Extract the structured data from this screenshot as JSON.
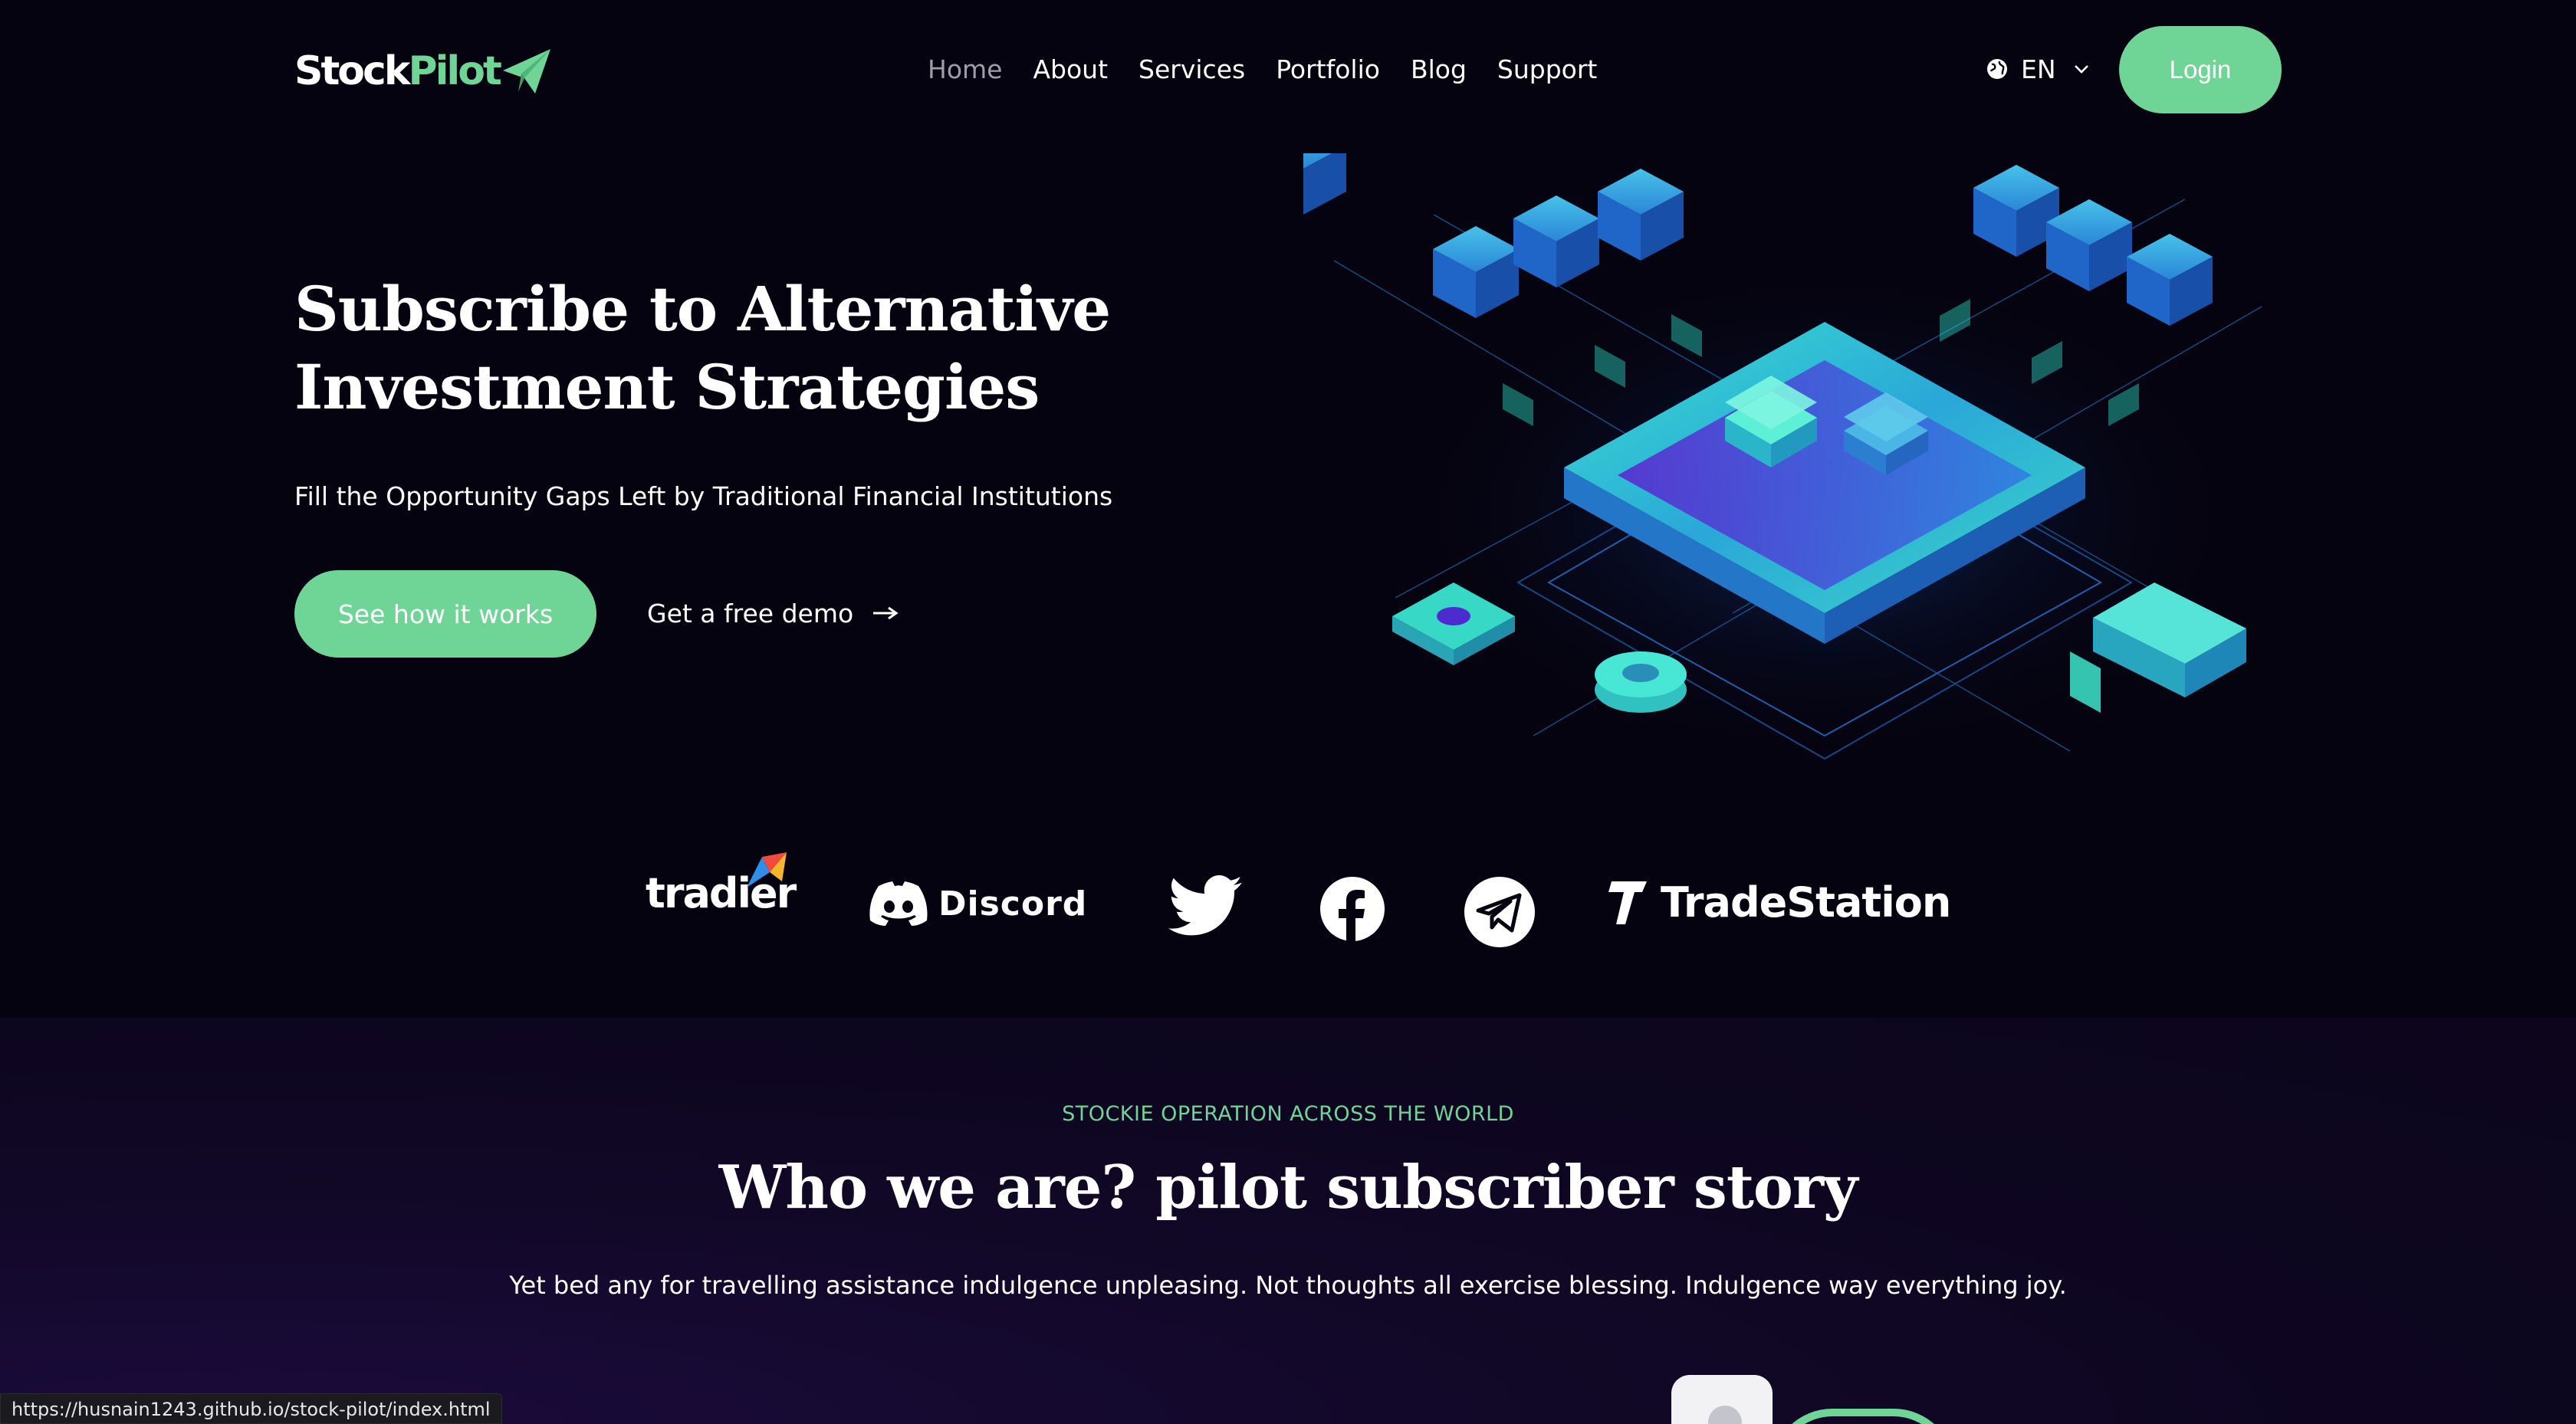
{
  "header": {
    "logo": {
      "part1": "Stock",
      "part2": "Pilot",
      "icon": "paper-plane-icon"
    },
    "nav": [
      {
        "label": "Home",
        "active": true
      },
      {
        "label": "About",
        "active": false
      },
      {
        "label": "Services",
        "active": false
      },
      {
        "label": "Portfolio",
        "active": false
      },
      {
        "label": "Blog",
        "active": false
      },
      {
        "label": "Support",
        "active": false
      }
    ],
    "language": {
      "icon": "globe-icon",
      "code": "EN"
    },
    "login_label": "Login"
  },
  "hero": {
    "title": "Subscribe to Alternative Investment Strategies",
    "subtitle": "Fill the Opportunity Gaps Left by Traditional Financial Institutions",
    "primary_cta": "See how it works",
    "secondary_cta": "Get a free demo"
  },
  "partners": [
    {
      "name": "tradier",
      "label": "tradier"
    },
    {
      "name": "discord",
      "label": "Discord"
    },
    {
      "name": "twitter",
      "label": ""
    },
    {
      "name": "facebook",
      "label": ""
    },
    {
      "name": "telegram",
      "label": ""
    },
    {
      "name": "tradestation",
      "label": "TradeStation"
    }
  ],
  "about": {
    "eyebrow": "STOCKIE OPERATION ACROSS THE WORLD",
    "title": "Who we are? pilot subscriber story",
    "text": "Yet bed any for travelling assistance indulgence unpleasing. Not thoughts all exercise blessing. Indulgence way everything joy."
  },
  "status_bar": {
    "url": "https://husnain1243.github.io/stock-pilot/index.html"
  },
  "colors": {
    "accent": "#6fd597",
    "background": "#05030f",
    "section_bg": "#110827"
  }
}
